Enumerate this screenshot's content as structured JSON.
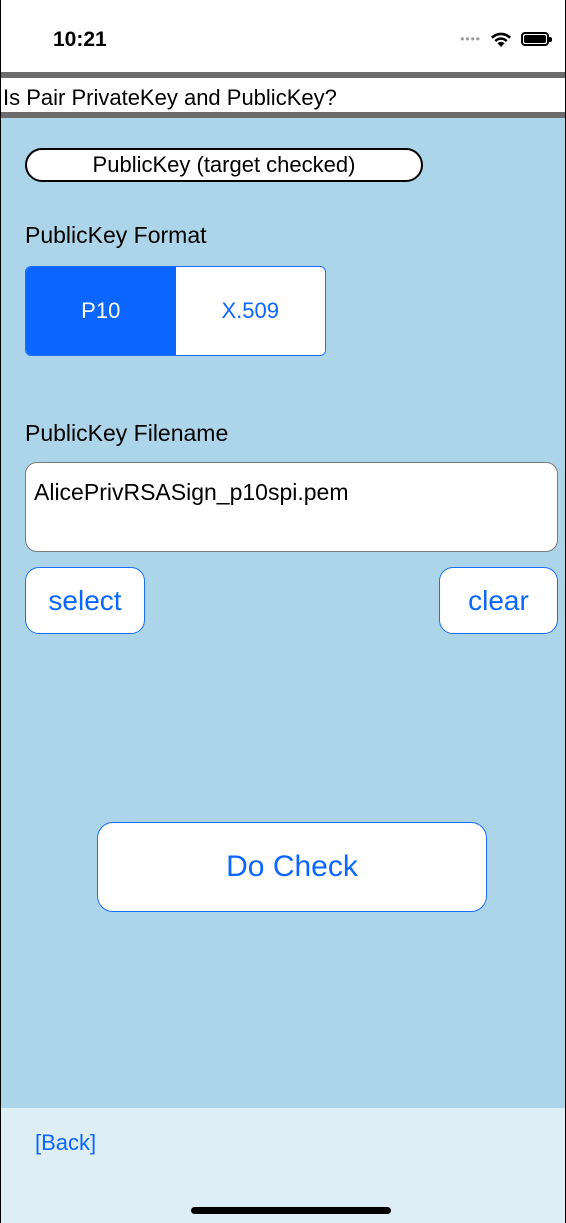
{
  "status_bar": {
    "time": "10:21",
    "icons": [
      "signal-dots-icon",
      "wifi-icon",
      "battery-icon"
    ]
  },
  "screen": {
    "title": "Is Pair PrivateKey and PublicKey?",
    "target_button_label": "PublicKey (target checked)",
    "format_label": "PublicKey Format",
    "format_options": [
      "P10",
      "X.509"
    ],
    "format_selected": "P10",
    "filename_label": "PublicKey Filename",
    "filename_value": "AlicePrivRSASign_p10spi.pem",
    "select_label": "select",
    "clear_label": "clear",
    "do_check_label": "Do Check"
  },
  "bottom": {
    "back_label": "[Back]"
  },
  "colors": {
    "main_background": "#add5e9",
    "accent": "#0a66ff",
    "bottom_background": "#ddeef6"
  }
}
